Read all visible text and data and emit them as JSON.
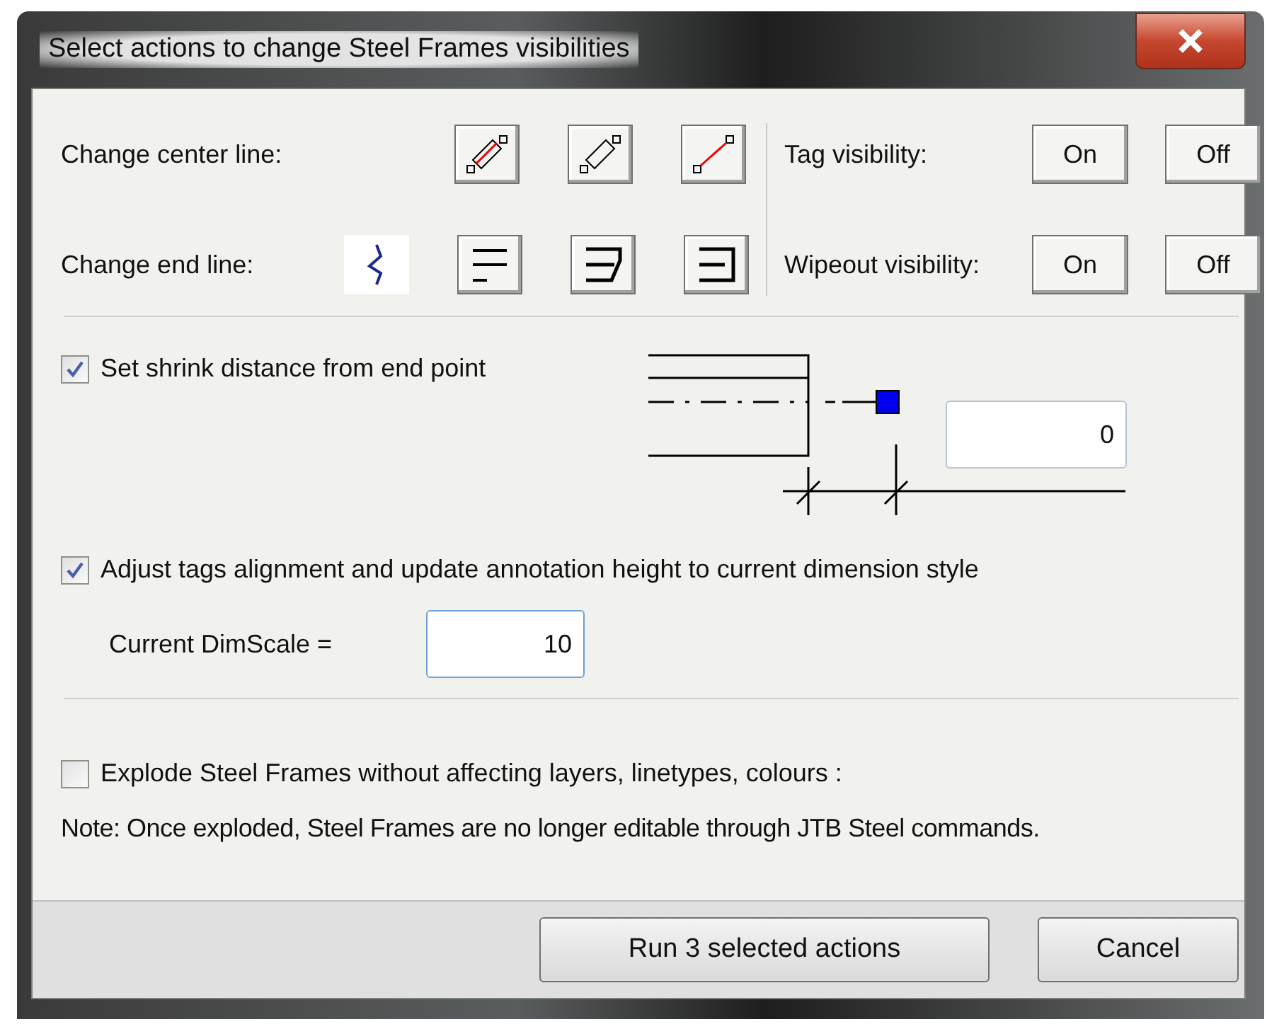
{
  "window": {
    "title": "Select actions to change Steel Frames visibilities"
  },
  "center_line": {
    "label": "Change center line:"
  },
  "end_line": {
    "label": "Change end line:"
  },
  "tag_visibility": {
    "label": "Tag visibility:",
    "buttons": [
      "On",
      "Off"
    ]
  },
  "wipeout_visibility": {
    "label": "Wipeout visibility:",
    "buttons": [
      "On",
      "Off"
    ]
  },
  "shrink": {
    "label": "Set shrink distance from end point",
    "checked": true,
    "value": "0"
  },
  "adjust": {
    "label": "Adjust tags alignment and update annotation height to current dimension style",
    "checked": true
  },
  "dimscale": {
    "label": "Current DimScale =",
    "value": "10"
  },
  "explode": {
    "label": "Explode Steel Frames without affecting layers, linetypes, colours :",
    "checked": false
  },
  "note": "Note: Once exploded, Steel Frames are no longer editable through JTB Steel commands.",
  "buttons": [
    "Run 3 selected actions",
    "Cancel"
  ]
}
